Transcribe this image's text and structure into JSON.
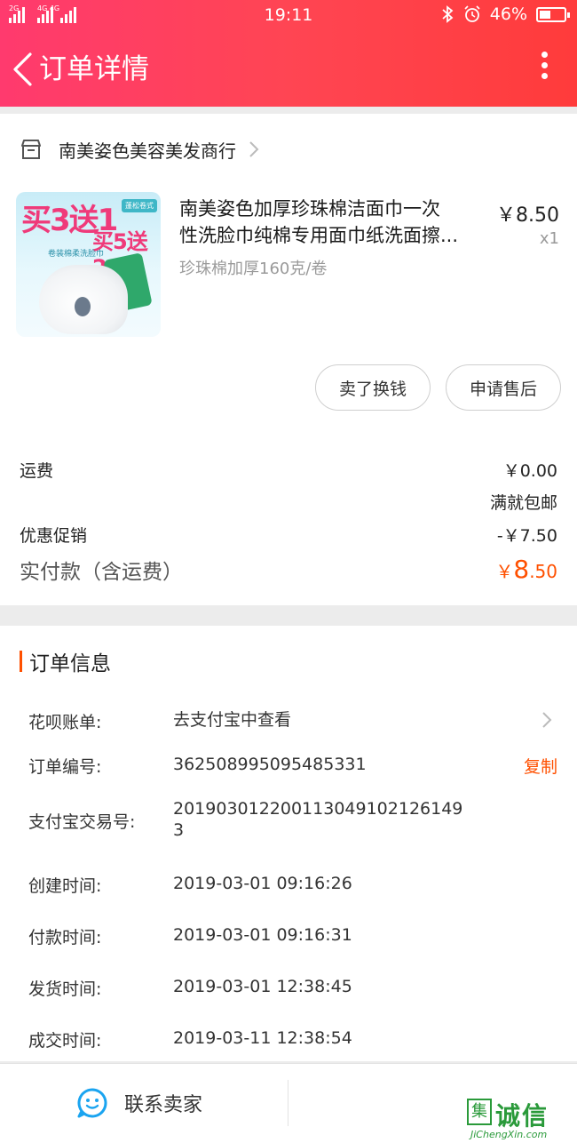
{
  "status_bar": {
    "signal1_tag": "2G",
    "signal2_tag": "4G 4G",
    "time": "19:11",
    "battery_percent": "46%",
    "icons": [
      "bluetooth-icon",
      "alarm-icon",
      "battery-icon"
    ]
  },
  "nav": {
    "title": "订单详情",
    "back_icon": "chevron-left-icon",
    "more_icon": "more-vertical-icon"
  },
  "shop": {
    "name": "南美姿色美容美发商行",
    "icon": "store-icon"
  },
  "product": {
    "title_line1": "南美姿色加厚珍珠棉洁面巾一次",
    "title_line2": "性洗脸巾纯棉专用面巾纸洗面擦...",
    "spec": "珍珠棉加厚160克/卷",
    "price": "￥8.50",
    "qty": "x1",
    "image_text1": "买3送1",
    "image_text2": "买5送2",
    "image_sub": "卷装棉柔洗脸巾",
    "image_badge": "蓬松卷式"
  },
  "actions": {
    "sell_label": "卖了换钱",
    "aftersale_label": "申请售后"
  },
  "fees": {
    "shipping_label": "运费",
    "shipping_value": "￥0.00",
    "shipping_note": "满就包邮",
    "discount_label": "优惠促销",
    "discount_value": "-￥7.50",
    "total_label": "实付款（含运费）",
    "total_currency": "￥",
    "total_int": "8",
    "total_dec": ".50"
  },
  "order_info": {
    "title": "订单信息",
    "huabei_label": "花呗账单:",
    "huabei_value": "去支付宝中查看",
    "order_no_label": "订单编号:",
    "order_no_value": "362508995095485331",
    "copy_label": "复制",
    "alipay_label": "支付宝交易号:",
    "alipay_value_line1": "201903012200113049102126149",
    "alipay_value_line2": "3",
    "created_label": "创建时间:",
    "created_value": "2019-03-01 09:16:26",
    "paid_label": "付款时间:",
    "paid_value": "2019-03-01 09:16:31",
    "shipped_label": "发货时间:",
    "shipped_value": "2019-03-01 12:38:45",
    "done_label": "成交时间:",
    "done_value": "2019-03-11 12:38:54"
  },
  "bottom": {
    "contact_label": "联系卖家",
    "contact_icon": "chat-bubble-icon"
  },
  "watermark": {
    "box": "集",
    "text": "诚信",
    "url": "JiChengXin.com"
  },
  "colors": {
    "header_start": "#ff3a6e",
    "header_end": "#ff3b3b",
    "accent": "#ff5000",
    "contact_blue": "#1aa4f0"
  }
}
